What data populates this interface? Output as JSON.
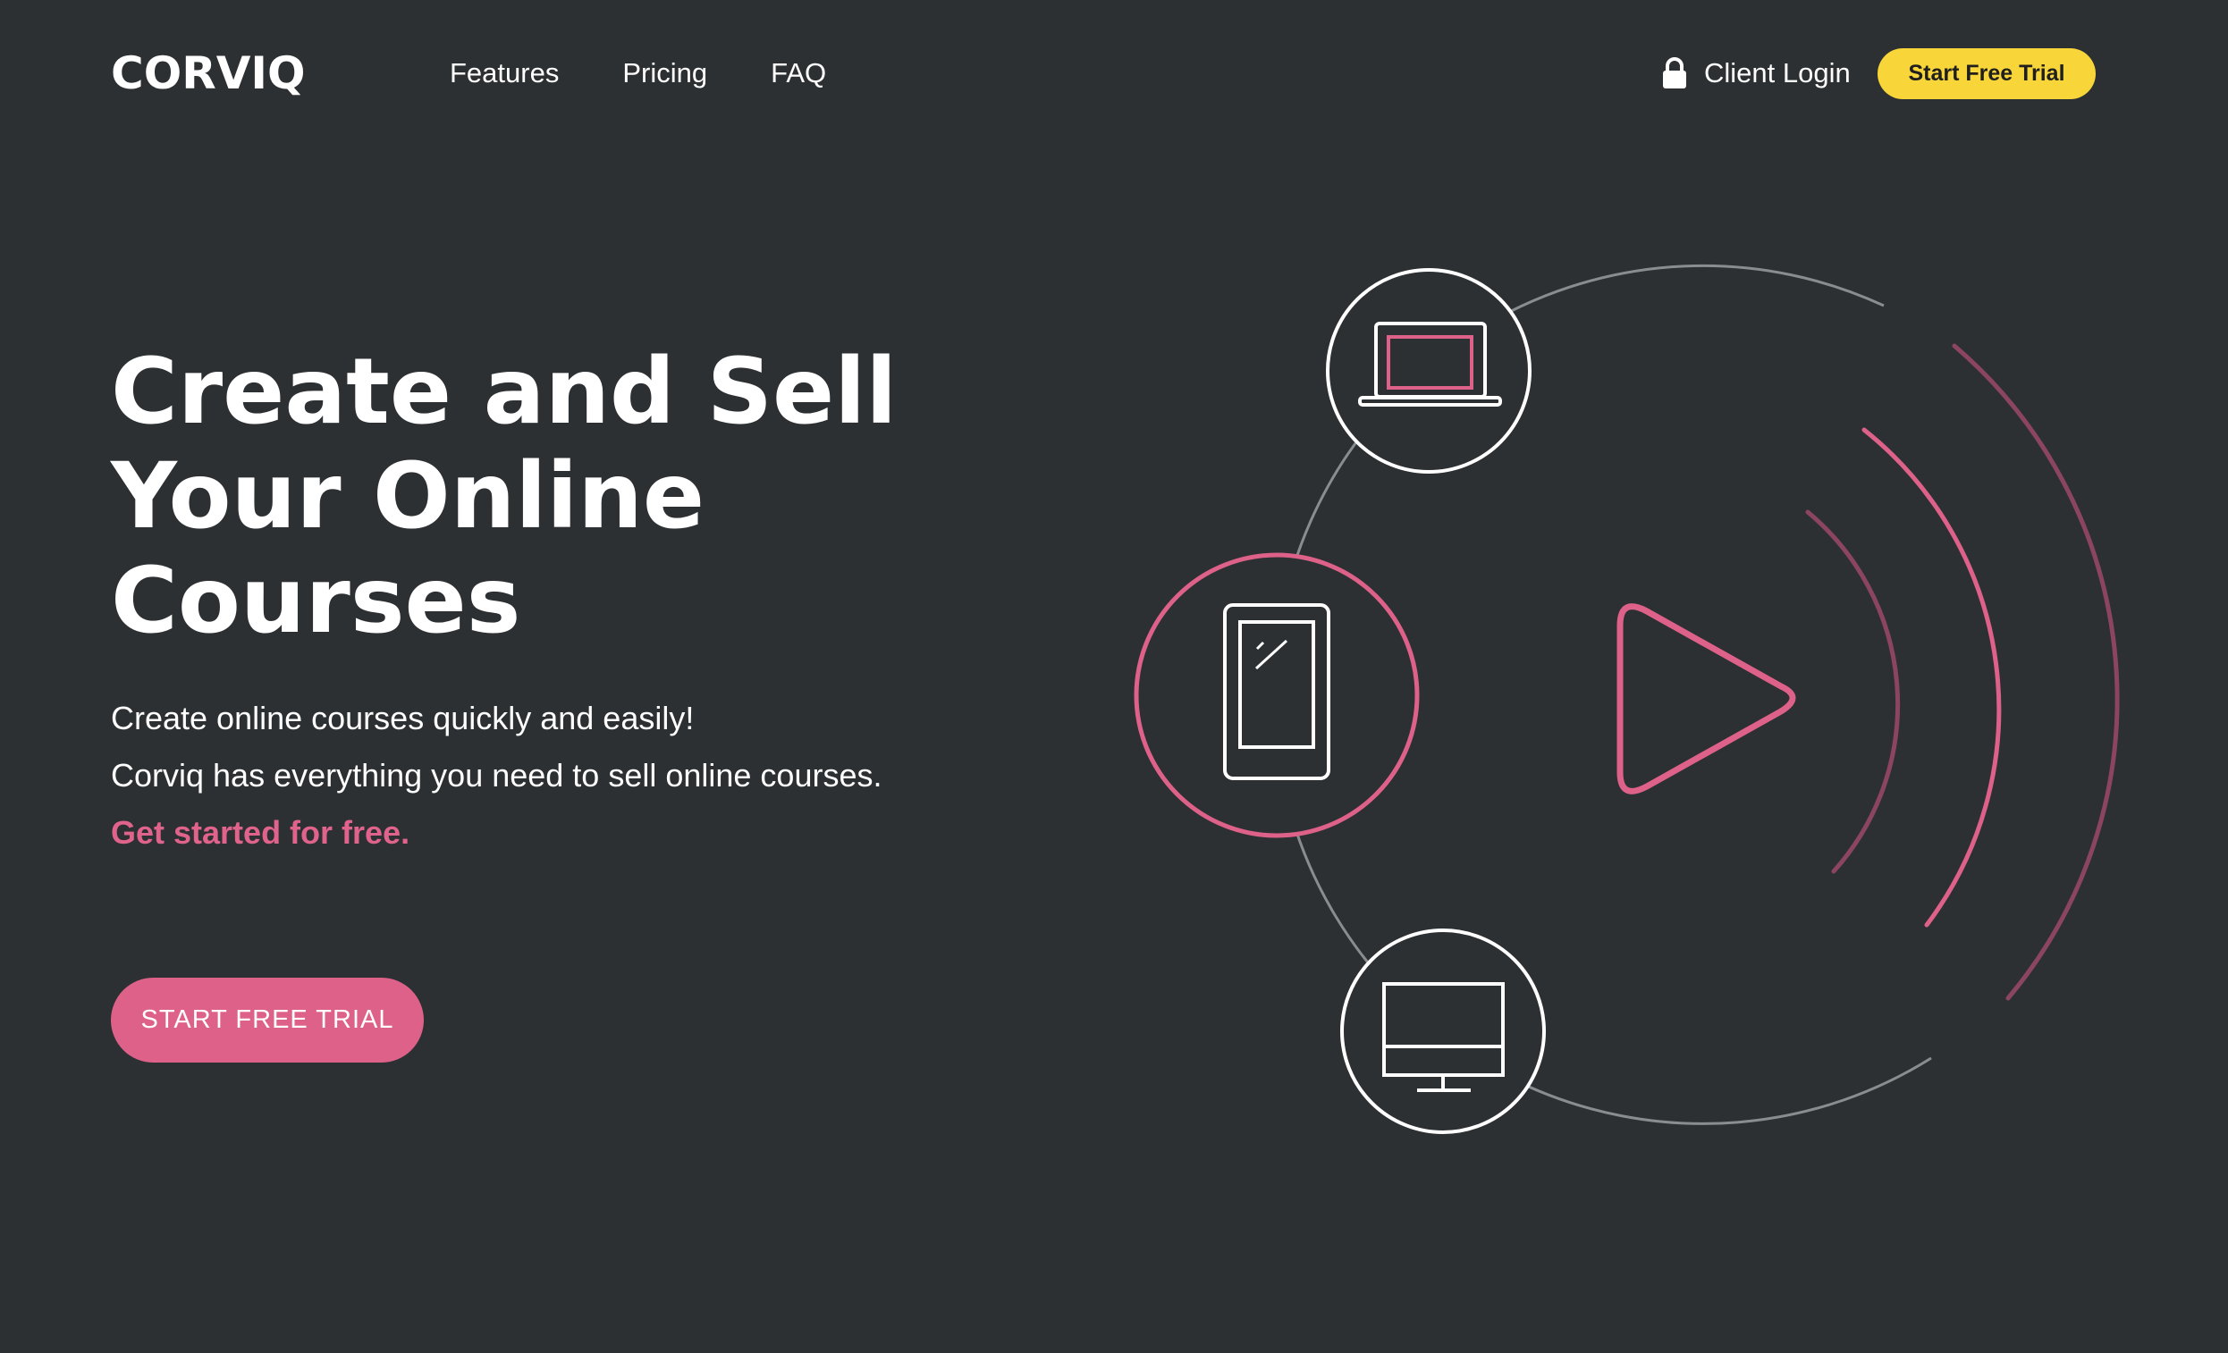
{
  "header": {
    "logo_text": "CORVIQ",
    "nav": [
      {
        "label": "Features"
      },
      {
        "label": "Pricing"
      },
      {
        "label": "FAQ"
      }
    ],
    "login_label": "Client Login",
    "login_icon": "lock-icon",
    "cta_label": "Start Free Trial"
  },
  "hero": {
    "title_lines": [
      "Create and Sell",
      "Your Online",
      "Courses"
    ],
    "description_lines": [
      "Create online courses quickly and easily!",
      "Corviq has everything you need to sell online courses."
    ],
    "accent_line": "Get started for free.",
    "cta_label": "START FREE TRIAL"
  },
  "illustration": {
    "icons": [
      "laptop-icon",
      "tablet-icon",
      "monitor-icon",
      "play-icon"
    ]
  },
  "colors": {
    "background": "#2c3033",
    "accent_pink": "#de6189",
    "accent_yellow": "#f8d538",
    "text": "#ffffff"
  }
}
